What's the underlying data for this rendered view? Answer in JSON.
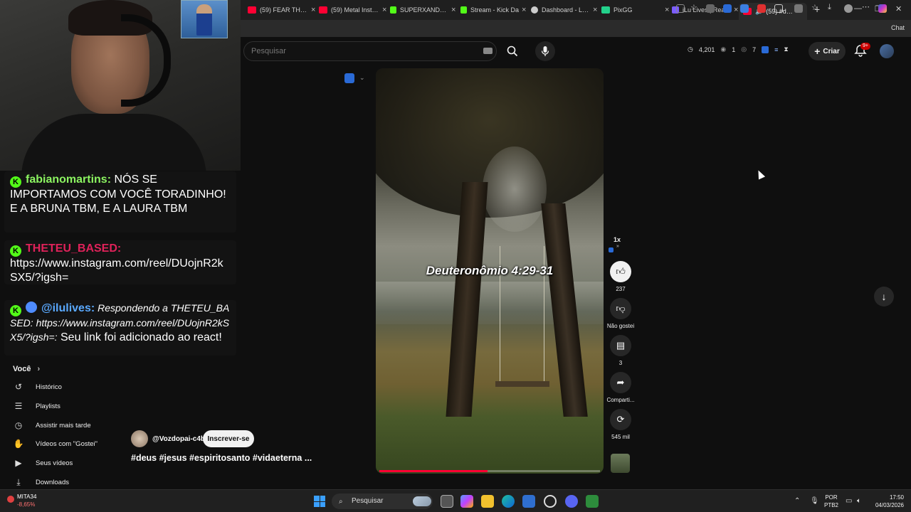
{
  "browser": {
    "tabs": [
      {
        "title": "(59) FEAR THE CI",
        "favicon": "youtube-icon",
        "color": "#ff0033"
      },
      {
        "title": "(59) Metal Instrum",
        "favicon": "youtube-icon",
        "color": "#ff0033"
      },
      {
        "title": "SUPERXANDAO S",
        "favicon": "kick-icon",
        "color": "#53fc18"
      },
      {
        "title": "Stream - Kick Da",
        "favicon": "kick-icon",
        "color": "#53fc18"
      },
      {
        "title": "Dashboard - Live",
        "favicon": "globe-icon",
        "color": "#cccccc"
      },
      {
        "title": "PixGG",
        "favicon": "pixgg-icon",
        "color": "#23d18b"
      },
      {
        "title": "iLu Lives | React",
        "favicon": "ilu-icon",
        "color": "#7b5cff"
      },
      {
        "title": "(59) #deus #",
        "favicon": "youtube-icon",
        "color": "#ff0033",
        "active": true
      }
    ],
    "chat_label": "Chat"
  },
  "header": {
    "search_placeholder": "Pesquisar",
    "stats": {
      "views": "4,201",
      "a": "1",
      "b": "7"
    },
    "create_label": "Criar",
    "notifications_badge": "9+"
  },
  "chat": {
    "messages": [
      {
        "user": "fabianomartins:",
        "text": " NÓS SE IMPORTAMOS COM VOCÊ TORADINHO! E A BRUNA TBM, E A LAURA TBM"
      },
      {
        "user": "THETEU_BASED:",
        "text": "https://www.instagram.com/reel/DUojnR2kSX5/?igsh="
      },
      {
        "user": "@ilulives:",
        "text_italic": " Respondendo a THETEU_BASED: https://www.instagram.com/reel/DUojnR2kSX5/?igsh=:",
        "text": " Seu link foi adicionado ao react!"
      }
    ]
  },
  "sidebar": {
    "section": "Você",
    "items": [
      {
        "label": "Histórico",
        "icon": "history-icon",
        "glyph": "↺"
      },
      {
        "label": "Playlists",
        "icon": "playlists-icon",
        "glyph": "☰"
      },
      {
        "label": "Assistir mais tarde",
        "icon": "clock-icon",
        "glyph": "◷"
      },
      {
        "label": "Vídeos com \"Gostei\"",
        "icon": "thumbs-up-icon",
        "glyph": "👍"
      },
      {
        "label": "Seus vídeos",
        "icon": "your-videos-icon",
        "glyph": "▶"
      },
      {
        "label": "Downloads",
        "icon": "download-icon",
        "glyph": "⤓"
      }
    ]
  },
  "video": {
    "verse": "Deuteronômio 4:29-31",
    "progress": 0.49,
    "channel": "@Vozdopai-c4b",
    "subscribe_label": "Inscrever-se",
    "tags": "#deus #jesus #espiritosanto #vidaeterna ..."
  },
  "rail": {
    "speed": "1x",
    "likes": "237",
    "dislike_label": "Não gostei",
    "comments": "3",
    "share_label": "Comparti...",
    "remix_count": "545 mil"
  },
  "taskbar": {
    "stock_name": "MITA34",
    "stock_change": "-8,65%",
    "search_label": "Pesquisar",
    "lang": "POR",
    "layout": "PTB2",
    "time": "17:50",
    "date": "04/03/2026"
  }
}
